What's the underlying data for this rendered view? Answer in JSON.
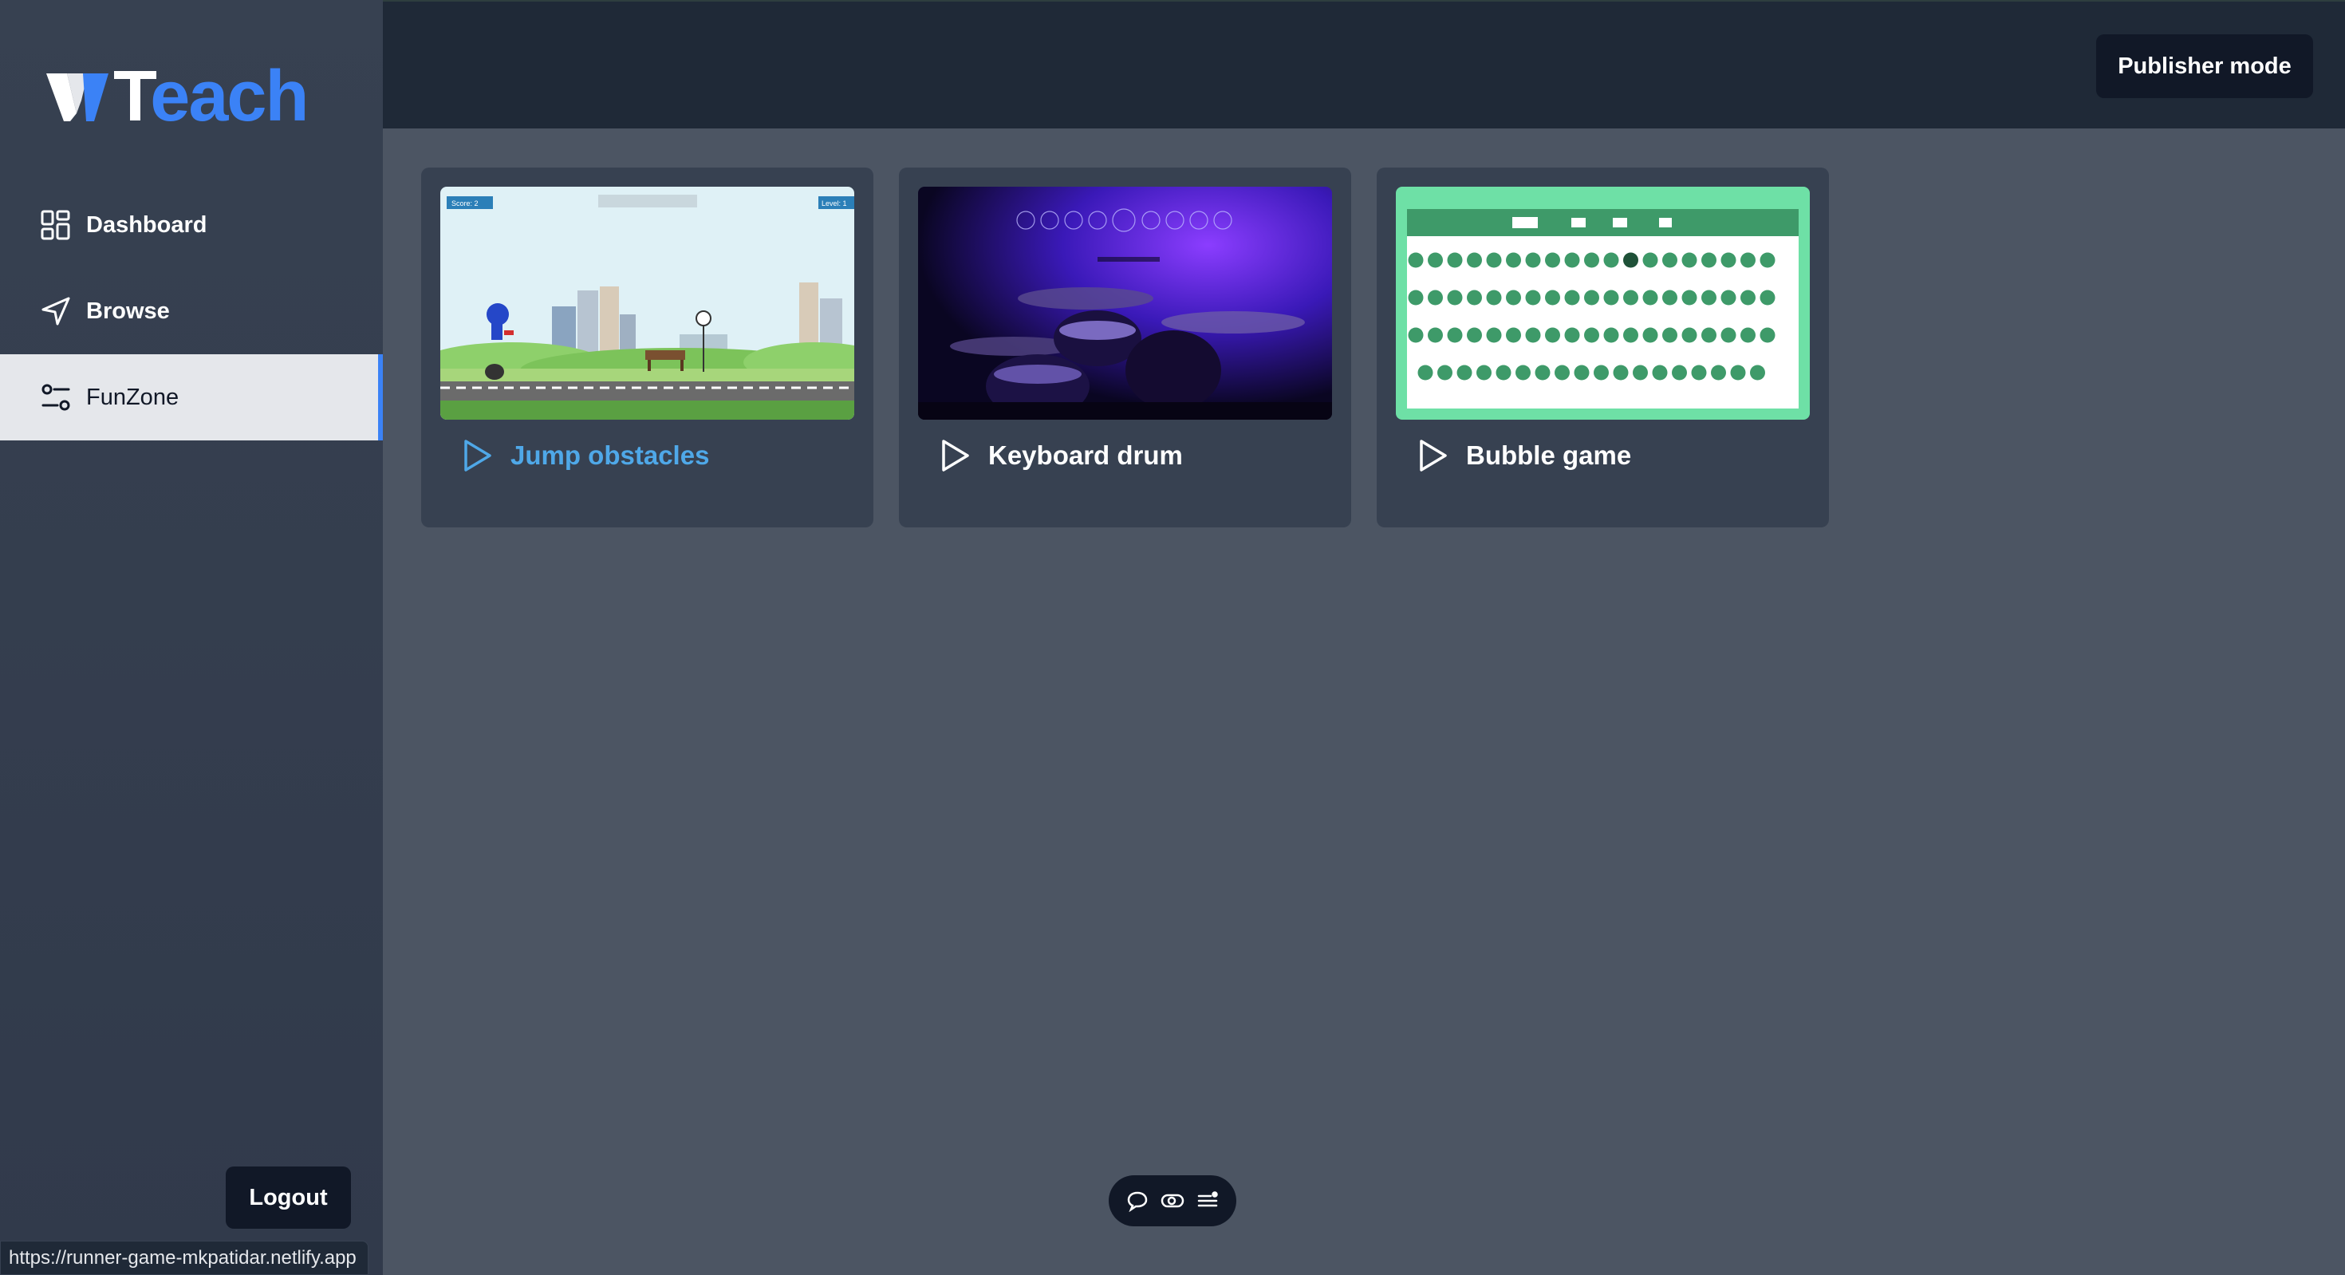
{
  "brand": {
    "logo_text_first": "T",
    "logo_text_rest": "each",
    "accent_color": "#3b82f6"
  },
  "sidebar": {
    "items": [
      {
        "label": "Dashboard",
        "icon": "grid-icon"
      },
      {
        "label": "Browse",
        "icon": "navigation-arrow-icon"
      },
      {
        "label": "FunZone",
        "icon": "sliders-icon",
        "active": true
      }
    ],
    "logout_label": "Logout"
  },
  "header": {
    "publisher_label": "Publisher mode"
  },
  "games": [
    {
      "title": "Jump obstacles",
      "title_color": "#4fa8e8",
      "thumb": "runner-game-thumbnail",
      "thumb_text": {
        "score": "Score: 2",
        "level": "Level: 1"
      }
    },
    {
      "title": "Keyboard drum",
      "title_color": "#ffffff",
      "thumb": "drum-kit-thumbnail"
    },
    {
      "title": "Bubble game",
      "title_color": "#ffffff",
      "thumb": "bubble-game-thumbnail"
    }
  ],
  "status_bar": {
    "url": "https://runner-game-mkpatidar.netlify.app"
  },
  "floating_toolbar": {
    "icons": [
      "comment-icon",
      "toggle-icon",
      "list-icon"
    ]
  }
}
